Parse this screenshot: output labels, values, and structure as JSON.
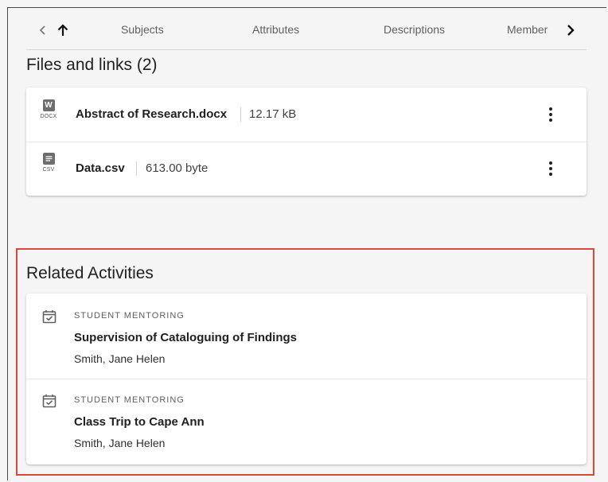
{
  "tabs": {
    "items": [
      "Subjects",
      "Attributes",
      "Descriptions",
      "Member"
    ],
    "back_icon": "chevron-left-icon",
    "up_icon": "arrow-up-icon",
    "next_icon": "chevron-right-icon"
  },
  "files": {
    "title": "Files and links (2)",
    "items": [
      {
        "icon": "word-document-icon",
        "icon_letter": "W",
        "ext": "DOCX",
        "name": "Abstract of Research.docx",
        "size": "12.17 kB"
      },
      {
        "icon": "text-file-icon",
        "icon_letter": "",
        "ext": "CSV",
        "name": "Data.csv",
        "size": "613.00 byte"
      }
    ]
  },
  "activities": {
    "title": "Related Activities",
    "items": [
      {
        "icon": "calendar-check-icon",
        "type": "Student Mentoring",
        "title": "Supervision of Cataloguing of Findings",
        "person": "Smith, Jane Helen"
      },
      {
        "icon": "calendar-check-icon",
        "type": "Student Mentoring",
        "title": "Class Trip to Cape Ann",
        "person": "Smith, Jane Helen"
      }
    ]
  },
  "colors": {
    "highlight": "#d9493f",
    "background": "#f5f5f5",
    "card": "#ffffff"
  }
}
